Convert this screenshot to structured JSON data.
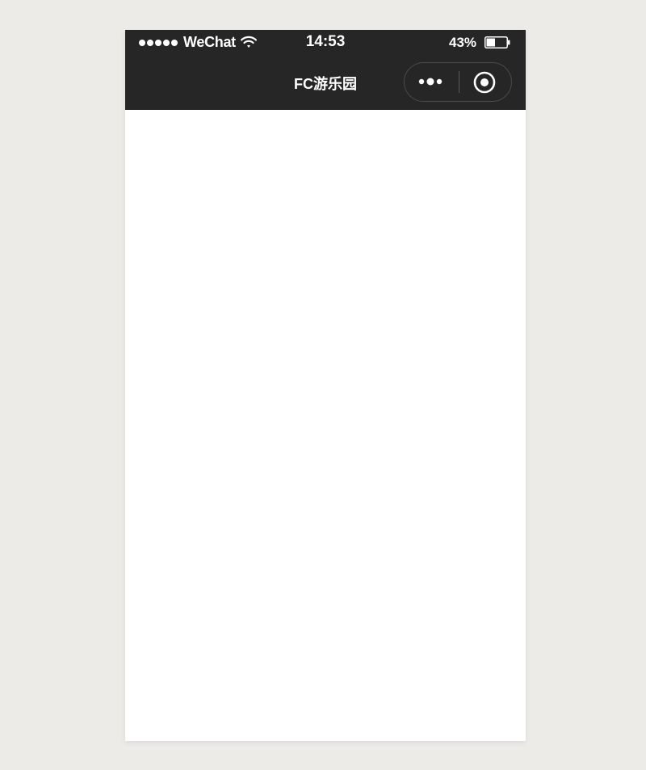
{
  "status_bar": {
    "signal_dots": 5,
    "carrier": "WeChat",
    "wifi_icon": "wifi-icon",
    "time": "14:53",
    "battery_percent": "43%",
    "battery_level": 0.43
  },
  "nav_bar": {
    "title": "FC游乐园",
    "more_icon": "more-dots-icon",
    "close_icon": "target-circle-icon"
  },
  "colors": {
    "page_background": "#edebe8",
    "nav_background": "#262626",
    "content_background": "#ffffff",
    "text": "#ffffff"
  }
}
